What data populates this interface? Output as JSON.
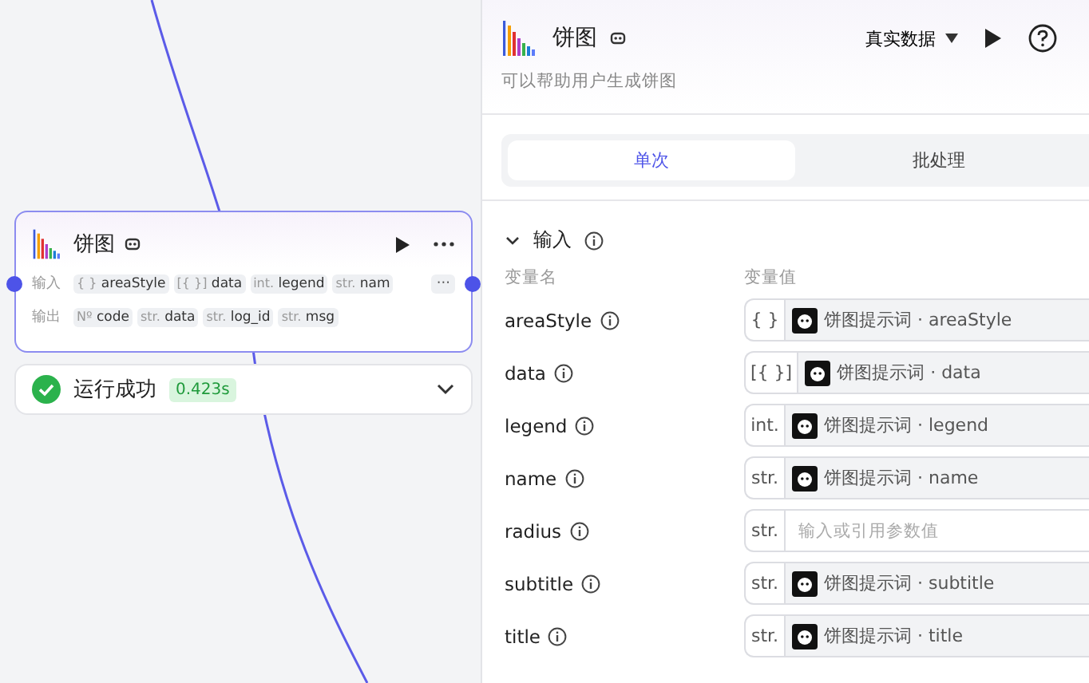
{
  "canvas": {
    "node": {
      "title": "饼图",
      "inputs_label": "输入",
      "inputs": [
        {
          "type": "{ }",
          "name": "areaStyle"
        },
        {
          "type": "[{ }]",
          "name": "data"
        },
        {
          "type": "int.",
          "name": "legend"
        },
        {
          "type": "str.",
          "name": "nam"
        }
      ],
      "more": "···",
      "outputs_label": "输出",
      "outputs": [
        {
          "type": "Nº",
          "name": "code"
        },
        {
          "type": "str.",
          "name": "data"
        },
        {
          "type": "str.",
          "name": "log_id"
        },
        {
          "type": "str.",
          "name": "msg"
        }
      ]
    },
    "run_status": {
      "text": "运行成功",
      "time": "0.423s"
    }
  },
  "panel": {
    "title": "饼图",
    "mode": "真实数据",
    "description": "可以帮助用户生成饼图",
    "tabs": [
      {
        "label": "单次",
        "selected": true
      },
      {
        "label": "批处理",
        "selected": false
      }
    ],
    "section": {
      "title": "输入",
      "expanded": true,
      "col_name": "变量名",
      "col_value": "变量值",
      "rows": [
        {
          "name": "areaStyle",
          "type": "{ }",
          "kind": "ref",
          "value": "饼图提示词 · areaStyle"
        },
        {
          "name": "data",
          "type": "[{ }]",
          "kind": "ref",
          "value": "饼图提示词 · data"
        },
        {
          "name": "legend",
          "type": "int.",
          "kind": "ref",
          "value": "饼图提示词 · legend"
        },
        {
          "name": "name",
          "type": "str.",
          "kind": "ref",
          "value": "饼图提示词 · name"
        },
        {
          "name": "radius",
          "type": "str.",
          "kind": "input",
          "placeholder": "输入或引用参数值"
        },
        {
          "name": "subtitle",
          "type": "str.",
          "kind": "ref",
          "value": "饼图提示词 · subtitle"
        },
        {
          "name": "title",
          "type": "str.",
          "kind": "ref",
          "value": "饼图提示词 · title"
        }
      ]
    }
  }
}
